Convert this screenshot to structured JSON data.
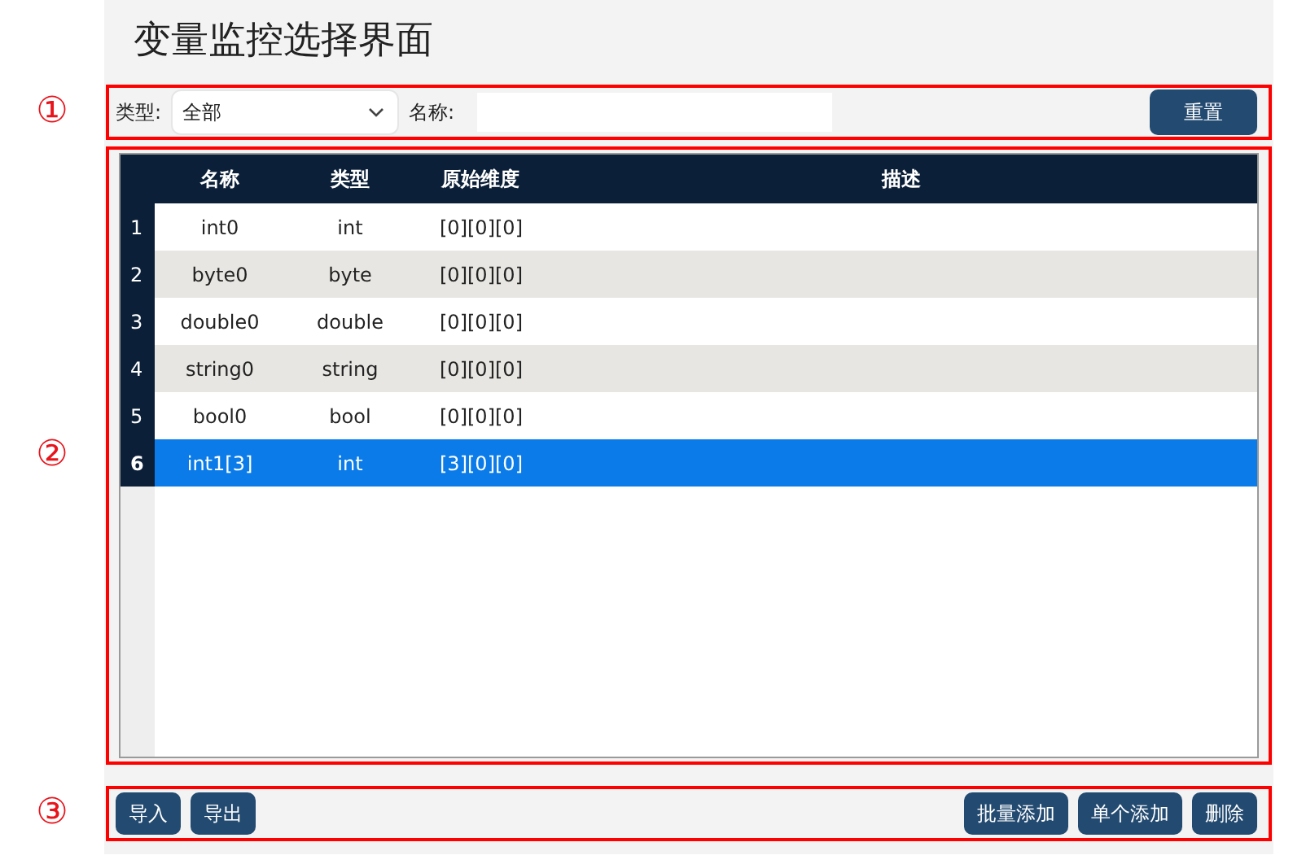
{
  "title": "变量监控选择界面",
  "callouts": [
    "①",
    "②",
    "③"
  ],
  "filter": {
    "type_label": "类型:",
    "type_value": "全部",
    "name_label": "名称:",
    "reset_button": "重置"
  },
  "table": {
    "columns": [
      "名称",
      "类型",
      "原始维度",
      "描述"
    ],
    "rows": [
      {
        "index": "1",
        "name": "int0",
        "type": "int",
        "dims": "[0][0][0]",
        "selected": false
      },
      {
        "index": "2",
        "name": "byte0",
        "type": "byte",
        "dims": "[0][0][0]",
        "selected": false
      },
      {
        "index": "3",
        "name": "double0",
        "type": "double",
        "dims": "[0][0][0]",
        "selected": false
      },
      {
        "index": "4",
        "name": "string0",
        "type": "string",
        "dims": "[0][0][0]",
        "selected": false
      },
      {
        "index": "5",
        "name": "bool0",
        "type": "bool",
        "dims": "[0][0][0]",
        "selected": false
      },
      {
        "index": "6",
        "name": "int1[3]",
        "type": "int",
        "dims": "[3][0][0]",
        "selected": true
      }
    ]
  },
  "toolbar": {
    "left": [
      "导入",
      "导出"
    ],
    "right": [
      "批量添加",
      "单个添加",
      "删除"
    ]
  }
}
